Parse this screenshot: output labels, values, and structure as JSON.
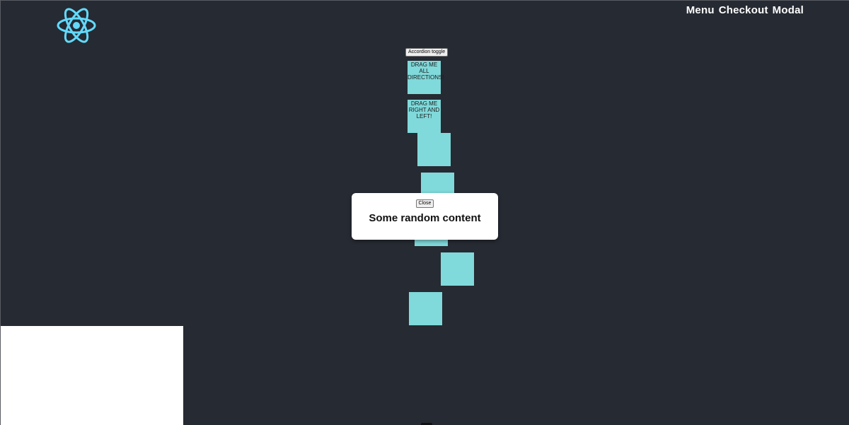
{
  "nav": {
    "items": [
      {
        "label": "Menu"
      },
      {
        "label": "Checkout"
      },
      {
        "label": "Modal"
      }
    ]
  },
  "logo": {
    "icon": "react-atom-icon",
    "color": "#61dafb"
  },
  "accordion": {
    "toggle_label": "Accordion toggle"
  },
  "draggables": [
    {
      "label": "DRAG ME ALL DIRECTIONS!"
    },
    {
      "label": "DRAG ME RIGHT AND LEFT!"
    },
    {
      "label": ""
    },
    {
      "label": ""
    },
    {
      "label": ""
    },
    {
      "label": ""
    },
    {
      "label": ""
    }
  ],
  "modal": {
    "close_label": "Close",
    "content": "Some random content"
  },
  "colors": {
    "background": "#262a32",
    "box": "#80d9da",
    "accent": "#61dafb"
  }
}
